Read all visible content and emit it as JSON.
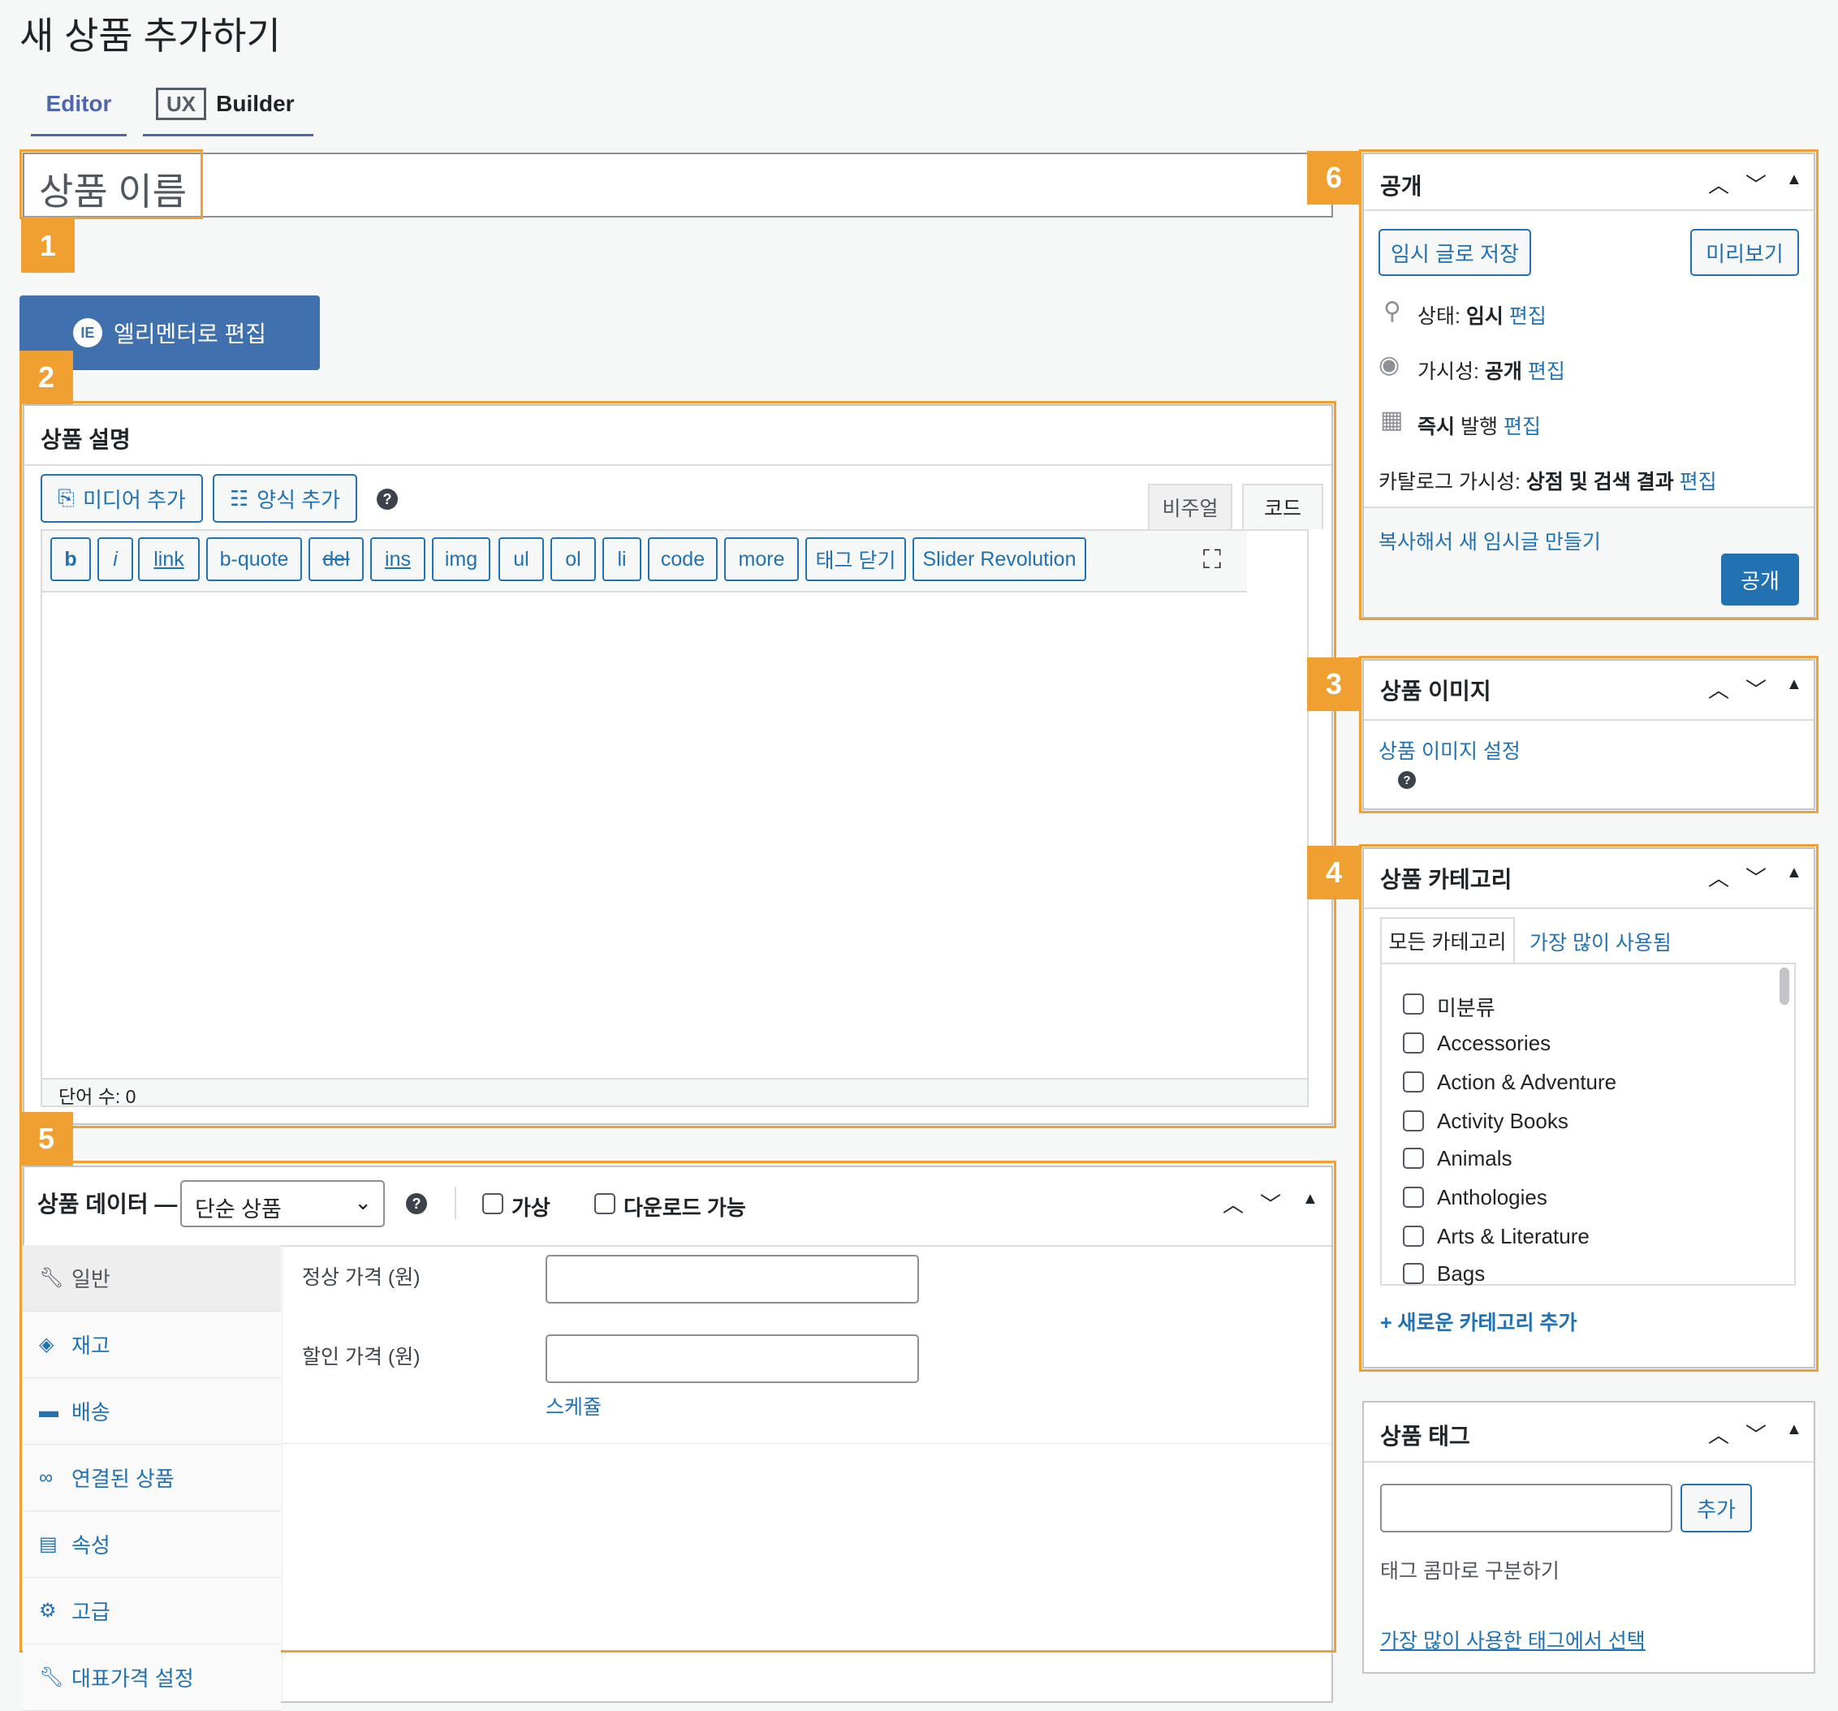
{
  "page": {
    "title": "새 상품 추가하기"
  },
  "mode_tabs": {
    "editor": "Editor",
    "ux_logo": "UX",
    "builder": "Builder"
  },
  "title_input": {
    "placeholder": "상품 이름"
  },
  "elementor_button": {
    "label": "엘리멘터로 편집"
  },
  "badges": [
    "1",
    "2",
    "3",
    "4",
    "5",
    "6"
  ],
  "description": {
    "title": "상품 설명",
    "add_media": "미디어 추가",
    "add_form": "양식 추가",
    "visual_tab": "비주얼",
    "code_tab": "코드",
    "quicktags": [
      "b",
      "i",
      "link",
      "b-quote",
      "del",
      "ins",
      "img",
      "ul",
      "ol",
      "li",
      "code",
      "more",
      "태그 닫기",
      "Slider Revolution"
    ],
    "word_count": "단어 수: 0"
  },
  "product_data": {
    "title": "상품 데이터 —",
    "type_select": "단순 상품",
    "virtual_label": "가상",
    "downloadable_label": "다운로드 가능",
    "tabs": [
      {
        "label": "일반",
        "icon": "wrench-icon"
      },
      {
        "label": "재고",
        "icon": "tag-icon"
      },
      {
        "label": "배송",
        "icon": "truck-icon"
      },
      {
        "label": "연결된 상품",
        "icon": "link-icon"
      },
      {
        "label": "속성",
        "icon": "list-icon"
      },
      {
        "label": "고급",
        "icon": "gear-icon"
      },
      {
        "label": "대표가격 설정",
        "icon": "wrench-icon"
      }
    ],
    "regular_price_label": "정상 가격 (원)",
    "sale_price_label": "할인 가격 (원)",
    "schedule_link": "스케쥴"
  },
  "publish": {
    "title": "공개",
    "save_draft": "임시 글로 저장",
    "preview": "미리보기",
    "status_label": "상태:",
    "status_value": "임시",
    "visibility_label": "가시성:",
    "visibility_value": "공개",
    "publish_time_bold": "즉시",
    "publish_time_rest": "발행",
    "catalog_label": "카탈로그 가시성:",
    "catalog_value": "상점 및 검색 결과",
    "edit_link": "편집",
    "copy_link": "복사해서 새 임시글 만들기",
    "publish_button": "공개"
  },
  "product_image": {
    "title": "상품 이미지",
    "set_link": "상품 이미지 설정"
  },
  "categories": {
    "title": "상품 카테고리",
    "tab_all": "모든 카테고리",
    "tab_popular": "가장 많이 사용됨",
    "items": [
      "미분류",
      "Accessories",
      "Action & Adventure",
      "Activity Books",
      "Animals",
      "Anthologies",
      "Arts & Literature",
      "Bags"
    ],
    "add_new": "+ 새로운 카테고리 추가"
  },
  "tags": {
    "title": "상품 태그",
    "add_button": "추가",
    "hint": "태그 콤마로 구분하기",
    "popular_link": "가장 많이 사용한 태그에서 선택"
  },
  "colors": {
    "accent": "#2271b1",
    "highlight": "#f0a030",
    "elementor": "#4170ae"
  }
}
